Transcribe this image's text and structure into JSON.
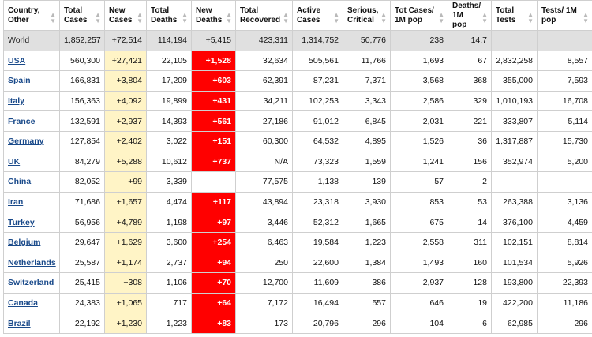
{
  "table": {
    "columns": [
      {
        "label": "Country, Other",
        "key": "country"
      },
      {
        "label": "Total Cases",
        "key": "total_cases"
      },
      {
        "label": "New Cases",
        "key": "new_cases"
      },
      {
        "label": "Total Deaths",
        "key": "total_deaths"
      },
      {
        "label": "New Deaths",
        "key": "new_deaths"
      },
      {
        "label": "Total Recovered",
        "key": "total_recovered"
      },
      {
        "label": "Active Cases",
        "key": "active_cases"
      },
      {
        "label": "Serious, Critical",
        "key": "serious_critical"
      },
      {
        "label": "Tot Cases/ 1M pop",
        "key": "tot_cases_1m"
      },
      {
        "label": "Deaths/ 1M pop",
        "key": "deaths_1m"
      },
      {
        "label": "Total Tests",
        "key": "total_tests"
      },
      {
        "label": "Tests/ 1M pop",
        "key": "tests_1m"
      }
    ],
    "world": {
      "country": "World",
      "total_cases": "1,852,257",
      "new_cases": "+72,514",
      "total_deaths": "114,194",
      "new_deaths": "+5,415",
      "total_recovered": "423,311",
      "active_cases": "1,314,752",
      "serious_critical": "50,776",
      "tot_cases_1m": "238",
      "deaths_1m": "14.7",
      "total_tests": "",
      "tests_1m": ""
    },
    "rows": [
      {
        "country": "USA",
        "total_cases": "560,300",
        "new_cases": "+27,421",
        "total_deaths": "22,105",
        "new_deaths": "+1,528",
        "total_recovered": "32,634",
        "active_cases": "505,561",
        "serious_critical": "11,766",
        "tot_cases_1m": "1,693",
        "deaths_1m": "67",
        "total_tests": "2,832,258",
        "tests_1m": "8,557"
      },
      {
        "country": "Spain",
        "total_cases": "166,831",
        "new_cases": "+3,804",
        "total_deaths": "17,209",
        "new_deaths": "+603",
        "total_recovered": "62,391",
        "active_cases": "87,231",
        "serious_critical": "7,371",
        "tot_cases_1m": "3,568",
        "deaths_1m": "368",
        "total_tests": "355,000",
        "tests_1m": "7,593"
      },
      {
        "country": "Italy",
        "total_cases": "156,363",
        "new_cases": "+4,092",
        "total_deaths": "19,899",
        "new_deaths": "+431",
        "total_recovered": "34,211",
        "active_cases": "102,253",
        "serious_critical": "3,343",
        "tot_cases_1m": "2,586",
        "deaths_1m": "329",
        "total_tests": "1,010,193",
        "tests_1m": "16,708"
      },
      {
        "country": "France",
        "total_cases": "132,591",
        "new_cases": "+2,937",
        "total_deaths": "14,393",
        "new_deaths": "+561",
        "total_recovered": "27,186",
        "active_cases": "91,012",
        "serious_critical": "6,845",
        "tot_cases_1m": "2,031",
        "deaths_1m": "221",
        "total_tests": "333,807",
        "tests_1m": "5,114"
      },
      {
        "country": "Germany",
        "total_cases": "127,854",
        "new_cases": "+2,402",
        "total_deaths": "3,022",
        "new_deaths": "+151",
        "total_recovered": "60,300",
        "active_cases": "64,532",
        "serious_critical": "4,895",
        "tot_cases_1m": "1,526",
        "deaths_1m": "36",
        "total_tests": "1,317,887",
        "tests_1m": "15,730"
      },
      {
        "country": "UK",
        "total_cases": "84,279",
        "new_cases": "+5,288",
        "total_deaths": "10,612",
        "new_deaths": "+737",
        "total_recovered": "N/A",
        "active_cases": "73,323",
        "serious_critical": "1,559",
        "tot_cases_1m": "1,241",
        "deaths_1m": "156",
        "total_tests": "352,974",
        "tests_1m": "5,200"
      },
      {
        "country": "China",
        "total_cases": "82,052",
        "new_cases": "+99",
        "total_deaths": "3,339",
        "new_deaths": "",
        "total_recovered": "77,575",
        "active_cases": "1,138",
        "serious_critical": "139",
        "tot_cases_1m": "57",
        "deaths_1m": "2",
        "total_tests": "",
        "tests_1m": ""
      },
      {
        "country": "Iran",
        "total_cases": "71,686",
        "new_cases": "+1,657",
        "total_deaths": "4,474",
        "new_deaths": "+117",
        "total_recovered": "43,894",
        "active_cases": "23,318",
        "serious_critical": "3,930",
        "tot_cases_1m": "853",
        "deaths_1m": "53",
        "total_tests": "263,388",
        "tests_1m": "3,136"
      },
      {
        "country": "Turkey",
        "total_cases": "56,956",
        "new_cases": "+4,789",
        "total_deaths": "1,198",
        "new_deaths": "+97",
        "total_recovered": "3,446",
        "active_cases": "52,312",
        "serious_critical": "1,665",
        "tot_cases_1m": "675",
        "deaths_1m": "14",
        "total_tests": "376,100",
        "tests_1m": "4,459"
      },
      {
        "country": "Belgium",
        "total_cases": "29,647",
        "new_cases": "+1,629",
        "total_deaths": "3,600",
        "new_deaths": "+254",
        "total_recovered": "6,463",
        "active_cases": "19,584",
        "serious_critical": "1,223",
        "tot_cases_1m": "2,558",
        "deaths_1m": "311",
        "total_tests": "102,151",
        "tests_1m": "8,814"
      },
      {
        "country": "Netherlands",
        "total_cases": "25,587",
        "new_cases": "+1,174",
        "total_deaths": "2,737",
        "new_deaths": "+94",
        "total_recovered": "250",
        "active_cases": "22,600",
        "serious_critical": "1,384",
        "tot_cases_1m": "1,493",
        "deaths_1m": "160",
        "total_tests": "101,534",
        "tests_1m": "5,926"
      },
      {
        "country": "Switzerland",
        "total_cases": "25,415",
        "new_cases": "+308",
        "total_deaths": "1,106",
        "new_deaths": "+70",
        "total_recovered": "12,700",
        "active_cases": "11,609",
        "serious_critical": "386",
        "tot_cases_1m": "2,937",
        "deaths_1m": "128",
        "total_tests": "193,800",
        "tests_1m": "22,393"
      },
      {
        "country": "Canada",
        "total_cases": "24,383",
        "new_cases": "+1,065",
        "total_deaths": "717",
        "new_deaths": "+64",
        "total_recovered": "7,172",
        "active_cases": "16,494",
        "serious_critical": "557",
        "tot_cases_1m": "646",
        "deaths_1m": "19",
        "total_tests": "422,200",
        "tests_1m": "11,186"
      },
      {
        "country": "Brazil",
        "total_cases": "22,192",
        "new_cases": "+1,230",
        "total_deaths": "1,223",
        "new_deaths": "+83",
        "total_recovered": "173",
        "active_cases": "20,796",
        "serious_critical": "296",
        "tot_cases_1m": "104",
        "deaths_1m": "6",
        "total_tests": "62,985",
        "tests_1m": "296"
      }
    ]
  },
  "colors": {
    "world_row_bg": "#e0e0e0",
    "new_cases_bg": "#fff4c6",
    "new_deaths_bg": "#ff0000",
    "country_link": "#1a4a8a"
  },
  "icons": {
    "sort": "sort-arrows-icon"
  }
}
